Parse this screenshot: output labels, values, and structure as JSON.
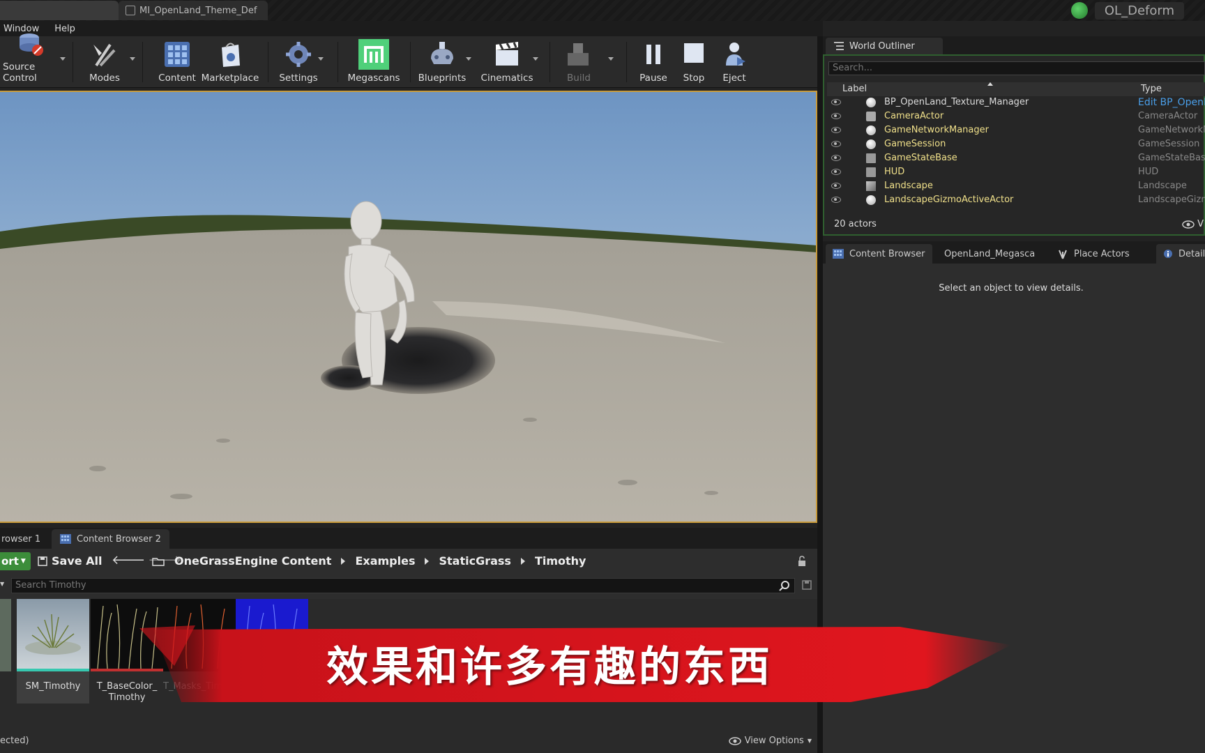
{
  "titlebar": {
    "doc_tab": "MI_OpenLand_Theme_Def",
    "project_name": "OL_Deform"
  },
  "menu": [
    "Window",
    "Help"
  ],
  "toolbar": {
    "buttons": [
      {
        "label": "Source Control",
        "icon": "source-control-icon"
      },
      {
        "label": "Modes",
        "icon": "modes-icon"
      },
      {
        "label": "Content",
        "icon": "content-icon"
      },
      {
        "label": "Marketplace",
        "icon": "marketplace-icon"
      },
      {
        "label": "Settings",
        "icon": "settings-icon"
      },
      {
        "label": "Megascans",
        "icon": "megascans-icon"
      },
      {
        "label": "Blueprints",
        "icon": "blueprints-icon"
      },
      {
        "label": "Cinematics",
        "icon": "cinematics-icon"
      },
      {
        "label": "Build",
        "icon": "build-icon",
        "disabled": true
      },
      {
        "label": "Pause",
        "icon": "pause-icon"
      },
      {
        "label": "Stop",
        "icon": "stop-icon"
      },
      {
        "label": "Eject",
        "icon": "eject-icon"
      }
    ]
  },
  "content_browser": {
    "tabs": [
      "rowser 1",
      "Content Browser 2"
    ],
    "import_label": "ort",
    "save_all": "Save All",
    "breadcrumbs": [
      "OneGrassEngine Content",
      "Examples",
      "StaticGrass",
      "Timothy"
    ],
    "search_placeholder": "Search Timothy",
    "assets": [
      {
        "name": "SM_Timothy",
        "selected": true
      },
      {
        "name": "T_BaseColor_\nTimothy"
      },
      {
        "name": "T_Masks_Timoth"
      },
      {
        "name": ""
      }
    ],
    "status": "ected)",
    "view_options": "View Options"
  },
  "world_outliner": {
    "tab": "World Outliner",
    "search_placeholder": "Search...",
    "col_label": "Label",
    "col_type": "Type",
    "rows": [
      {
        "label": "BP_OpenLand_Texture_Manager",
        "type": "Edit BP_OpenL"
      },
      {
        "label": "CameraActor",
        "type": "CameraActor"
      },
      {
        "label": "GameNetworkManager",
        "type": "GameNetworkMa"
      },
      {
        "label": "GameSession",
        "type": "GameSession"
      },
      {
        "label": "GameStateBase",
        "type": "GameStateBase"
      },
      {
        "label": "HUD",
        "type": "HUD"
      },
      {
        "label": "Landscape",
        "type": "Landscape"
      },
      {
        "label": "LandscapeGizmoActiveActor",
        "type": "LandscapeGizmo"
      }
    ],
    "actor_count": "20 actors",
    "view_label": "V"
  },
  "lower_tabs": [
    "Content Browser",
    "OpenLand_Megasca",
    "Place Actors",
    "Detail"
  ],
  "details_message": "Select an object to view details.",
  "subtitle": "效果和许多有趣的东西",
  "colors": {
    "accent_green": "#3c8d3a",
    "viewport_border": "#c89a3a",
    "banner_red": "#d8141c",
    "outliner_name": "#f0e08a"
  }
}
